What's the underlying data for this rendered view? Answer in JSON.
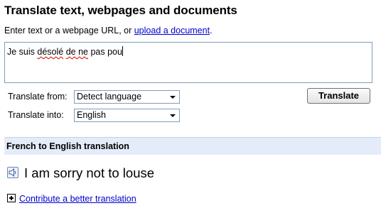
{
  "page_title": "Translate text, webpages and documents",
  "intro": {
    "text": "Enter text or a webpage URL, or ",
    "link": "upload a document",
    "suffix": "."
  },
  "source_text": {
    "before": "Je suis ",
    "misspelt_1": "désolé",
    "mid_1": " ",
    "misspelt_2": "de ne",
    "after": " pas pou"
  },
  "translate_from": {
    "label": "Translate from:",
    "selected": "Detect language"
  },
  "translate_into": {
    "label": "Translate into:",
    "selected": "English"
  },
  "translate_button": "Translate",
  "result": {
    "header": "French to English translation",
    "text": "I am sorry not to louse",
    "speaker_icon": "speaker-icon"
  },
  "contribute": {
    "icon": "plus-icon",
    "link": "Contribute a better translation"
  },
  "colors": {
    "link": "#0000cc",
    "result_header_bg": "#e5ecf9",
    "input_border": "#7f9db9",
    "spellcheck": "#d00000"
  }
}
